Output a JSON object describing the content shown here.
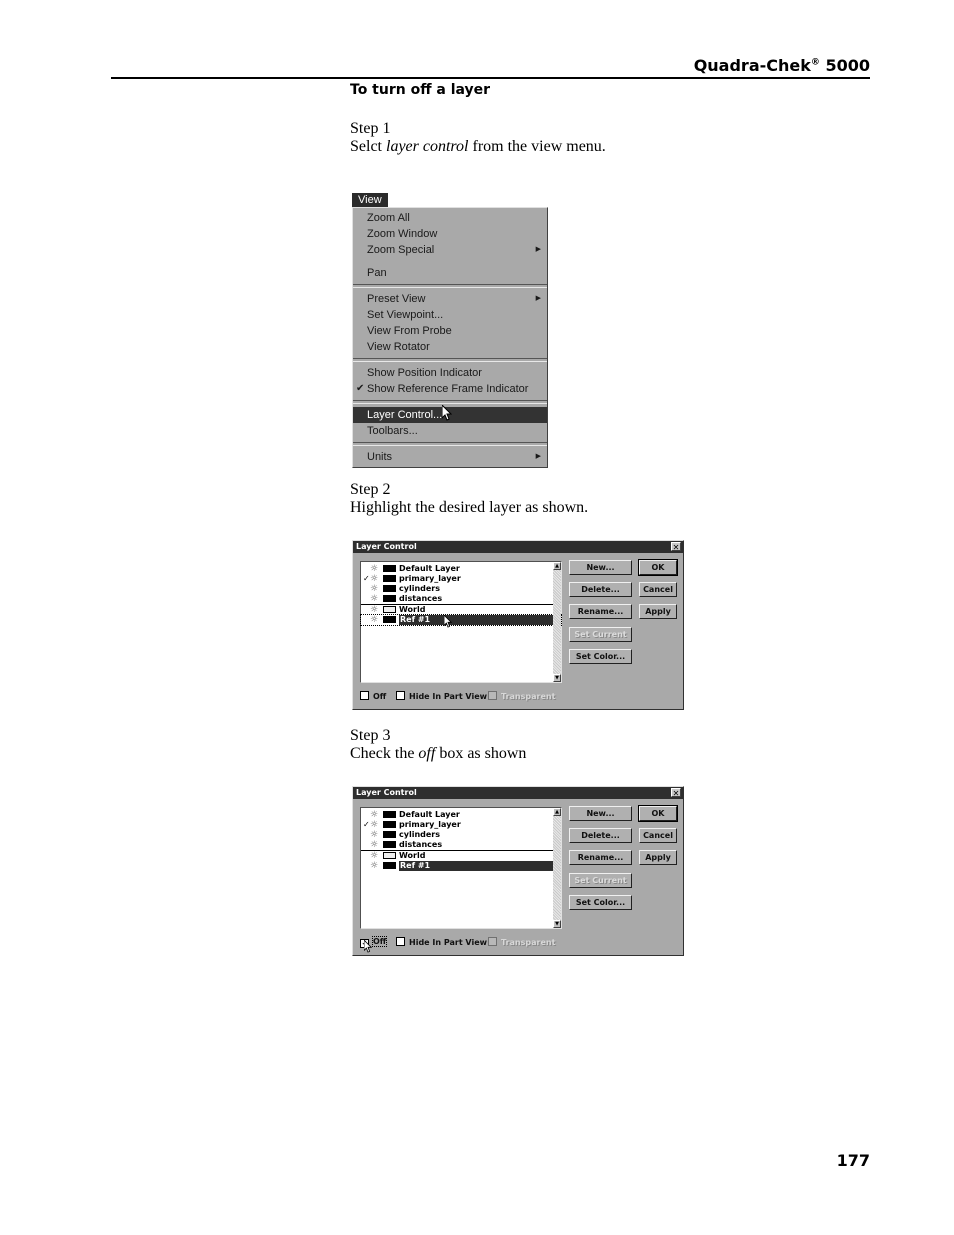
{
  "header": {
    "product": "Quadra-Chek",
    "registered": "®",
    "model": "5000"
  },
  "section_title": "To turn off a layer",
  "steps": [
    {
      "label": "Step 1",
      "text_before": "Selct ",
      "text_italic": "layer control",
      "text_after": " from the view menu."
    },
    {
      "label": "Step 2",
      "text": "Highlight the desired layer as shown."
    },
    {
      "label": "Step 3",
      "text_before": "Check the ",
      "text_italic": "off",
      "text_after": " box as shown"
    }
  ],
  "view_menu": {
    "title": "View",
    "items": [
      {
        "label": "Zoom All"
      },
      {
        "label": "Zoom Window"
      },
      {
        "label": "Zoom Special",
        "submenu": "▶"
      },
      {
        "label": "Pan"
      },
      {
        "label": "Preset View",
        "submenu": "▶"
      },
      {
        "label": "Set Viewpoint..."
      },
      {
        "label": "View From Probe"
      },
      {
        "label": "View Rotator"
      },
      {
        "label": "Show Position Indicator"
      },
      {
        "label": "Show Reference Frame Indicator",
        "check": "✔"
      },
      {
        "label": "Layer Control...",
        "highlighted": true
      },
      {
        "label": "Toolbars..."
      },
      {
        "label": "Units",
        "submenu": "▶"
      }
    ]
  },
  "dialogs": [
    {
      "title": "Layer Control",
      "close": "✕",
      "layers": [
        {
          "name": "Default Layer",
          "check": "",
          "swatch": "black"
        },
        {
          "name": "primary_layer",
          "check": "✓",
          "swatch": "black"
        },
        {
          "name": "cylinders",
          "check": "",
          "swatch": "black"
        },
        {
          "name": "distances",
          "check": "",
          "swatch": "black"
        },
        {
          "name": "World",
          "check": "",
          "swatch": "white"
        },
        {
          "name": "Ref #1",
          "check": "",
          "swatch": "black",
          "selected": true
        }
      ],
      "buttons": {
        "new": "New...",
        "delete": "Delete...",
        "rename": "Rename...",
        "set_current": "Set Current",
        "set_color": "Set Color...",
        "ok": "OK",
        "cancel": "Cancel",
        "apply": "Apply"
      },
      "options": {
        "off": "Off",
        "off_checked": false,
        "hide": "Hide In Part View",
        "hide_checked": false,
        "transparent": "Transparent",
        "transparent_enabled": false
      }
    },
    {
      "title": "Layer Control",
      "close": "✕",
      "layers": [
        {
          "name": "Default Layer",
          "check": "",
          "swatch": "black"
        },
        {
          "name": "primary_layer",
          "check": "✓",
          "swatch": "black"
        },
        {
          "name": "cylinders",
          "check": "",
          "swatch": "black"
        },
        {
          "name": "distances",
          "check": "",
          "swatch": "black"
        },
        {
          "name": "World",
          "check": "",
          "swatch": "white"
        },
        {
          "name": "Ref #1",
          "check": "",
          "swatch": "black",
          "selected": true
        }
      ],
      "buttons": {
        "new": "New...",
        "delete": "Delete...",
        "rename": "Rename...",
        "set_current": "Set Current",
        "set_color": "Set Color...",
        "ok": "OK",
        "cancel": "Cancel",
        "apply": "Apply"
      },
      "options": {
        "off": "Off",
        "off_checked": true,
        "off_check_glyph": "✓",
        "hide": "Hide In Part View",
        "hide_checked": false,
        "transparent": "Transparent",
        "transparent_enabled": false
      }
    }
  ],
  "page_number": "177"
}
